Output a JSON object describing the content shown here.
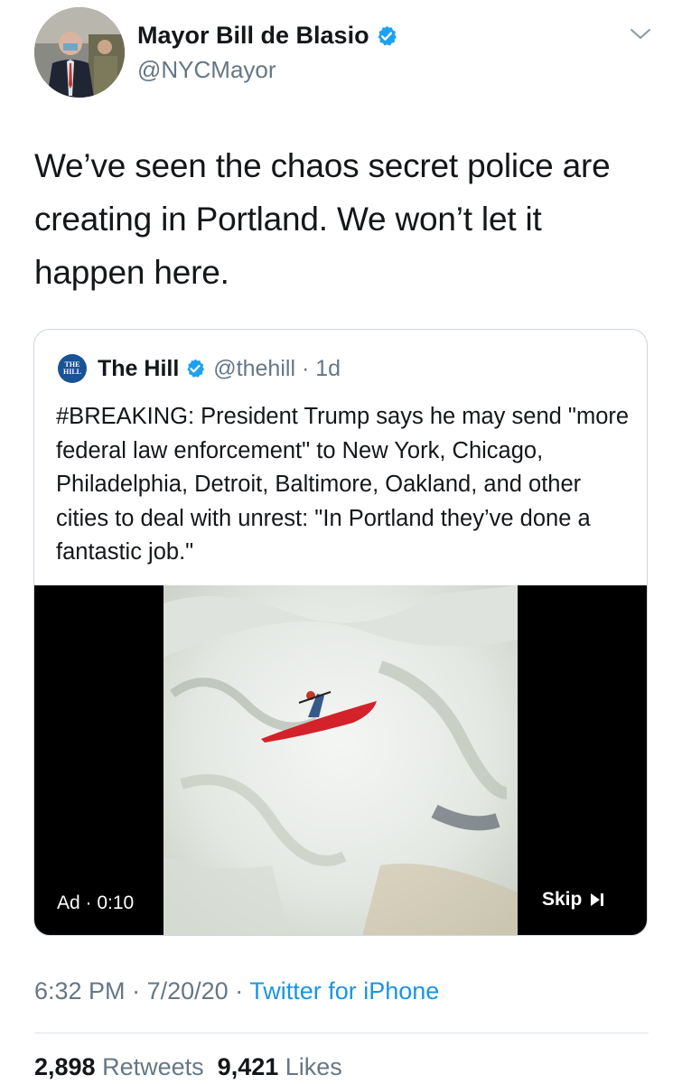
{
  "author": {
    "display_name": "Mayor Bill de Blasio",
    "handle": "@NYCMayor",
    "verified_icon": "verified-badge-icon",
    "avatar_icon": "profile-photo"
  },
  "tweet": {
    "text": "We’ve seen the chaos secret police are creating in Portland. We won’t let it happen here."
  },
  "quoted": {
    "logo_text_top": "THE",
    "logo_text_bottom": "HILL",
    "name": "The Hill",
    "handle": "@thehill",
    "age": "1d",
    "text": "#BREAKING: President Trump says he may send \"more federal law enforcement\" to New York, Chicago, Philadelphia, Detroit, Baltimore, Oakland, and other cities to deal with unrest: \"In Portland they’ve done a fantastic job.\"",
    "video": {
      "ad_label": "Ad",
      "time": "0:10",
      "skip_label": "Skip"
    }
  },
  "meta": {
    "time": "6:32 PM",
    "date": "7/20/20",
    "source": "Twitter for iPhone"
  },
  "stats": {
    "retweets_count": "2,898",
    "retweets_label": "Retweets",
    "likes_count": "9,421",
    "likes_label": "Likes"
  },
  "colors": {
    "link_blue": "#1b95e0",
    "secondary_gray": "#657786",
    "border": "#ccd6dd"
  }
}
